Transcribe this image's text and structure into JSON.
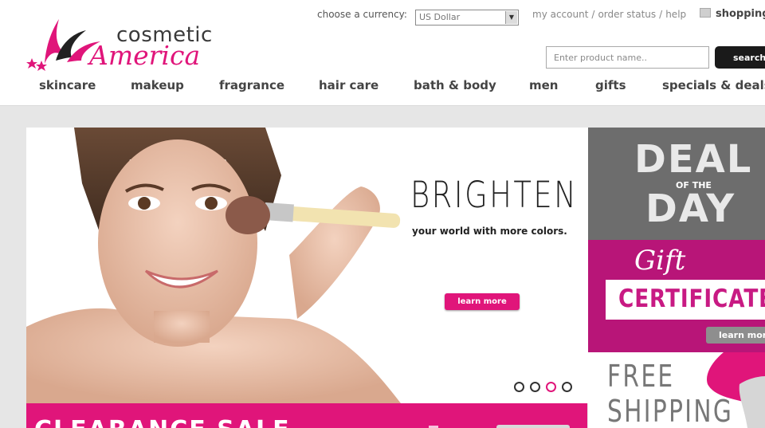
{
  "brand": {
    "name_top": "cosmetic",
    "name_bottom": "America",
    "brand_color": "#e0157a"
  },
  "currency": {
    "label": "choose a currency:",
    "selected": "US Dollar"
  },
  "top_links": {
    "my_account": "my account",
    "order_status": "order status",
    "help": "help",
    "separator": "/",
    "cart": "shopping"
  },
  "search": {
    "placeholder": "Enter product name..",
    "button": "search"
  },
  "nav": [
    {
      "label": "skincare"
    },
    {
      "label": "makeup"
    },
    {
      "label": "fragrance"
    },
    {
      "label": "hair care"
    },
    {
      "label": "bath & body"
    },
    {
      "label": "men"
    },
    {
      "label": "gifts"
    },
    {
      "label": "specials & deals"
    }
  ],
  "hero": {
    "headline": "BRIGHTEN",
    "subline": "your world with more colors.",
    "cta": "learn more",
    "slide_count": 4,
    "active_slide": 3
  },
  "clearance": {
    "title": "CLEARANCE SALE"
  },
  "sidebar": {
    "deal": {
      "line1": "DEAL",
      "line2": "OF THE",
      "line3": "DAY"
    },
    "gift": {
      "line1": "Gift",
      "line2": "CERTIFICATE",
      "cta": "learn more"
    },
    "shipping": {
      "line1": "FREE",
      "line2": "SHIPPING"
    }
  },
  "colors": {
    "accent": "#e0157a",
    "gift_bg": "#b81578",
    "deal_bg": "#6d6d6d",
    "page_bg": "#e6e6e6"
  },
  "icons": {
    "logo_mark": "swoosh-stars",
    "cart": "shopping-bag-icon",
    "dropdown": "chevron-down-icon"
  }
}
